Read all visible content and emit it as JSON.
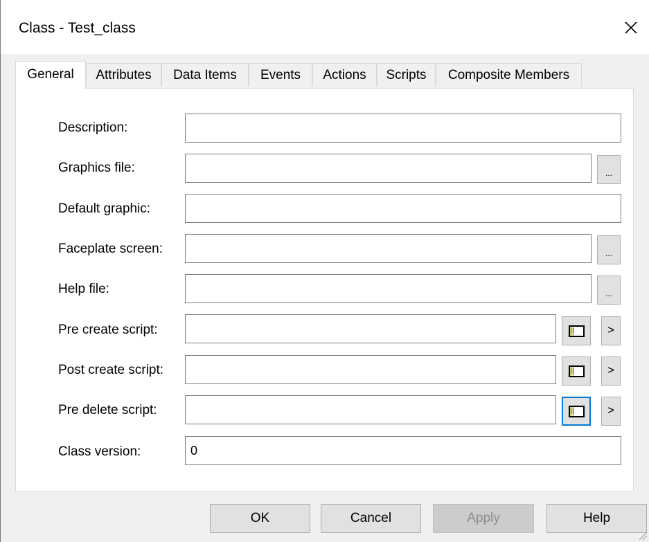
{
  "window": {
    "title": "Class - Test_class",
    "close_icon": "close-icon"
  },
  "tabs": [
    {
      "label": "General",
      "active": true
    },
    {
      "label": "Attributes",
      "active": false
    },
    {
      "label": "Data Items",
      "active": false
    },
    {
      "label": "Events",
      "active": false
    },
    {
      "label": "Actions",
      "active": false
    },
    {
      "label": "Scripts",
      "active": false
    },
    {
      "label": "Composite Members",
      "active": false
    }
  ],
  "general": {
    "description": {
      "label": "Description:",
      "value": ""
    },
    "graphics_file": {
      "label": "Graphics file:",
      "value": "",
      "browse": "..."
    },
    "default_graphic": {
      "label": "Default graphic:",
      "value": ""
    },
    "faceplate_screen": {
      "label": "Faceplate screen:",
      "value": "",
      "browse": "..."
    },
    "help_file": {
      "label": "Help file:",
      "value": "",
      "browse": "..."
    },
    "pre_create_script": {
      "label": "Pre create script:",
      "value": "",
      "arrow": ">"
    },
    "post_create_script": {
      "label": "Post create script:",
      "value": "",
      "arrow": ">"
    },
    "pre_delete_script": {
      "label": "Pre delete script:",
      "value": "",
      "arrow": ">"
    },
    "class_version": {
      "label": "Class version:",
      "value": "0"
    }
  },
  "buttons": {
    "ok": "OK",
    "cancel": "Cancel",
    "apply": "Apply",
    "help": "Help"
  },
  "colors": {
    "focus": "#0078d7",
    "dialog_bg": "#f0f0f0"
  }
}
